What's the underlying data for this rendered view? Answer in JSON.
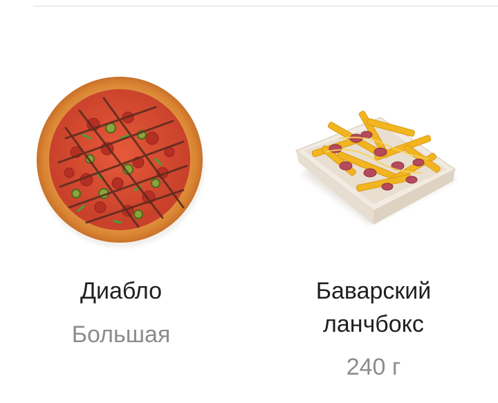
{
  "products": [
    {
      "name": "Диабло",
      "detail": "Большая",
      "image": "pizza-diablo-image"
    },
    {
      "name": "Баварский\nланчбокс",
      "detail": "240 г",
      "image": "bavarian-lunchbox-image"
    }
  ],
  "colors": {
    "name_text": "#1f1f1f",
    "detail_text": "#8c8c8c",
    "divider": "#ececec",
    "background": "#ffffff"
  }
}
